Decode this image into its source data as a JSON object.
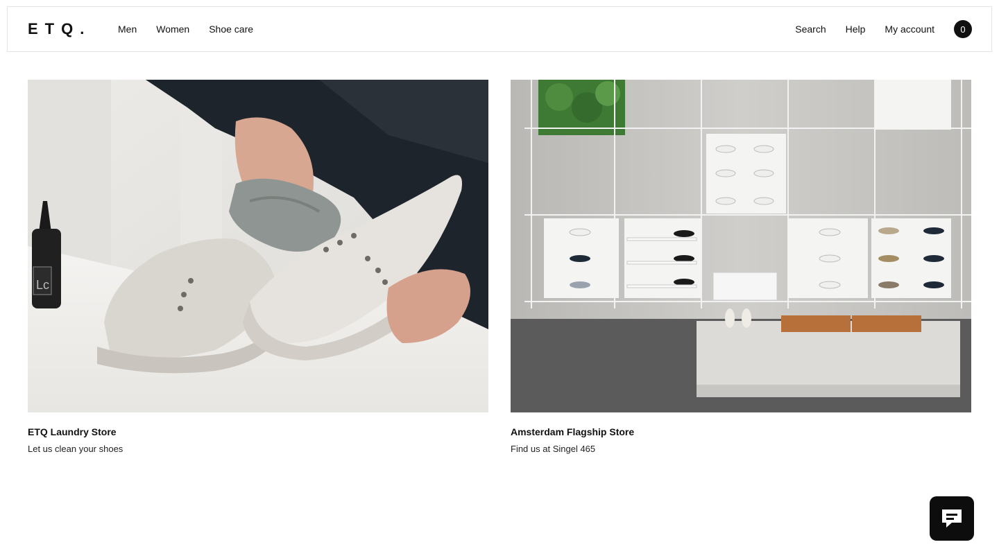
{
  "header": {
    "logo": "ETQ.",
    "nav_left": [
      "Men",
      "Women",
      "Shoe care"
    ],
    "nav_right": [
      "Search",
      "Help",
      "My account"
    ],
    "cart_count": "0"
  },
  "cards": [
    {
      "title": "ETQ Laundry Store",
      "subtitle": "Let us clean your shoes",
      "image": "hand cleaning white sneaker with cloth, LC bottle"
    },
    {
      "title": "Amsterdam Flagship Store",
      "subtitle": "Find us at Singel 465",
      "image": "store interior with shoe display wall and concrete bench"
    }
  ],
  "chat": {
    "icon": "chat-icon"
  },
  "colors": {
    "text": "#111111",
    "accent": "#0d0d0d",
    "border": "#e3e3e3"
  }
}
